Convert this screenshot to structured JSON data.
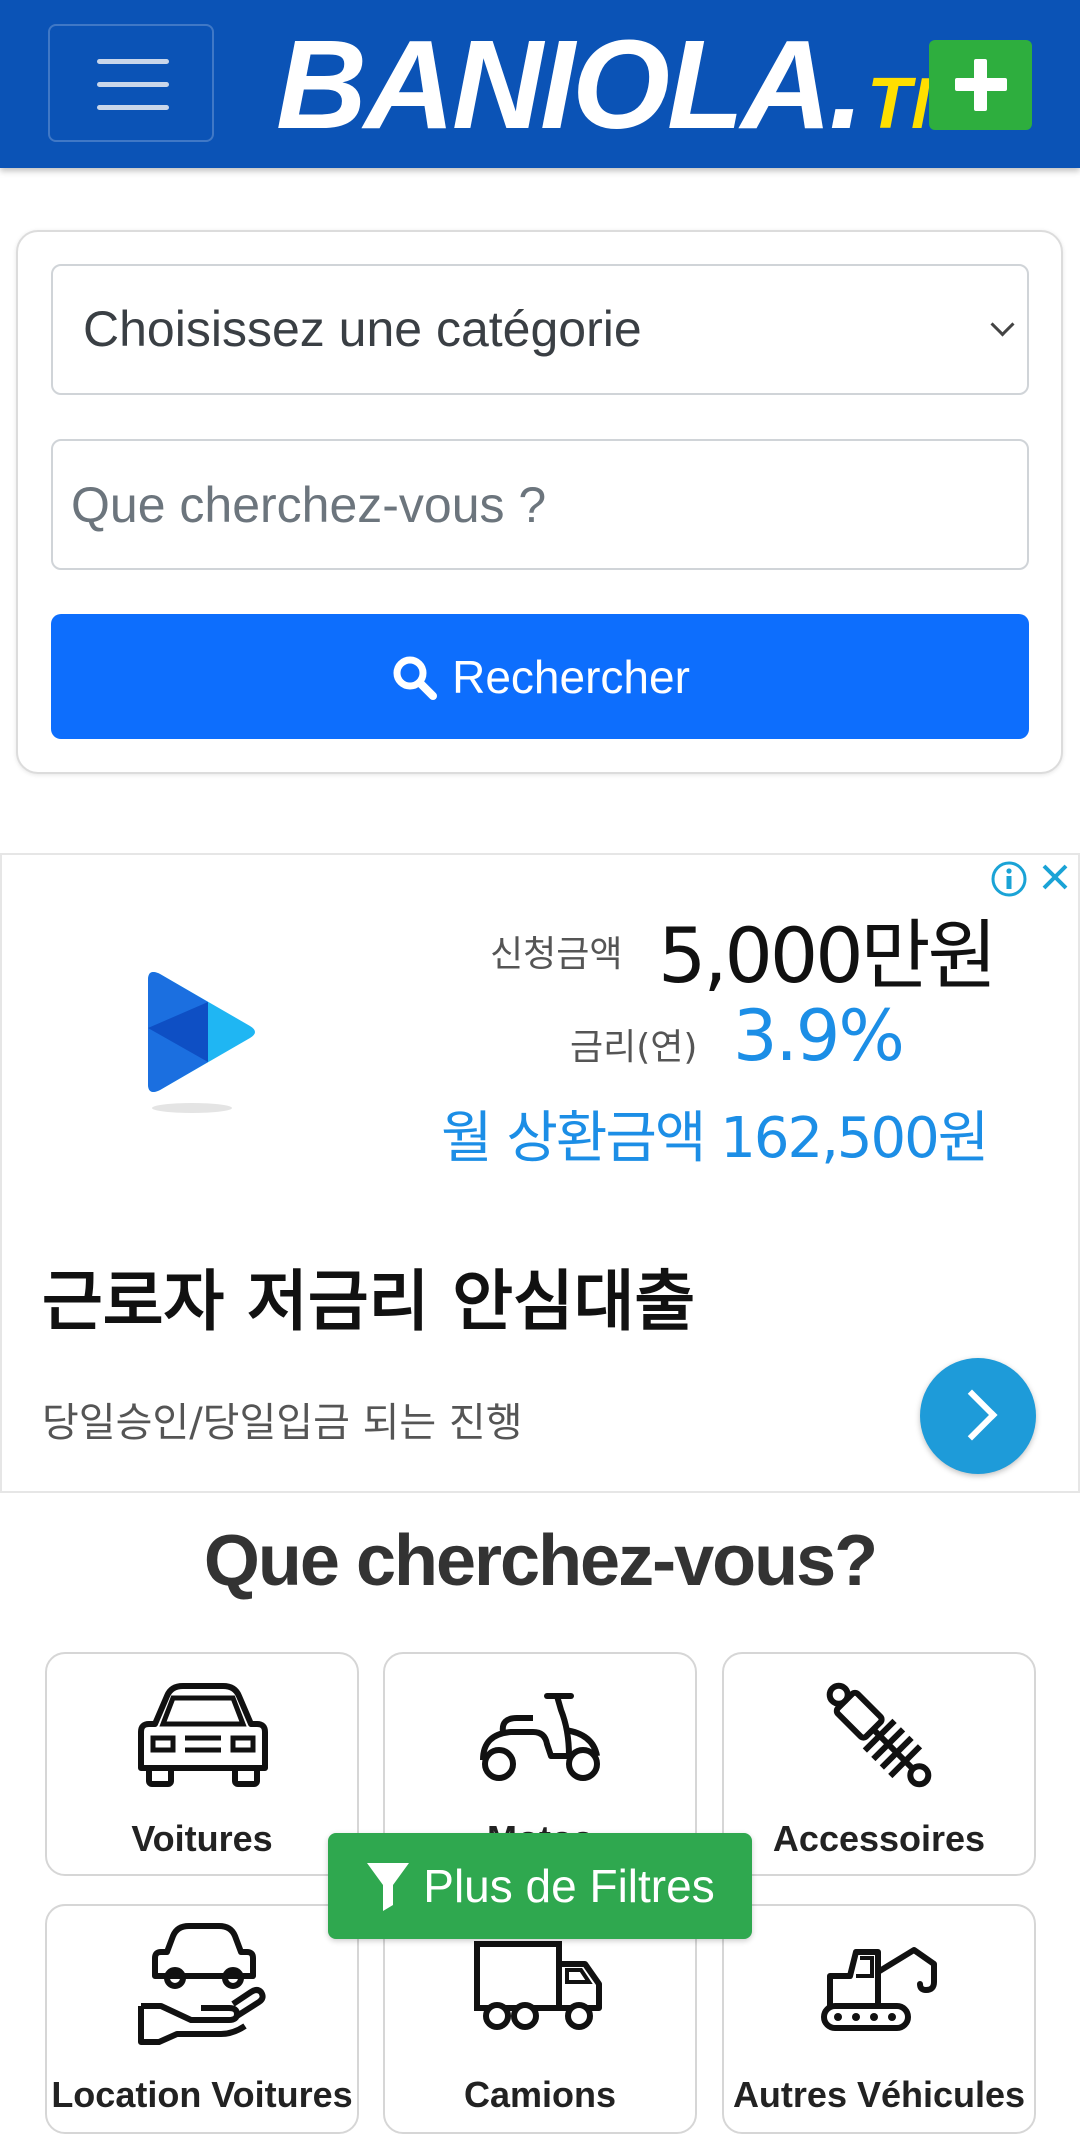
{
  "header": {
    "logo_main": "BANIOLA.",
    "logo_tld": "TN",
    "brand_color": "#0b53b6",
    "accent_color": "#ffdf00",
    "add_button_color": "#2eae3e"
  },
  "search": {
    "category_value": "Choisissez une catégorie",
    "query_placeholder": "Que cherchez-vous ?",
    "query_value": "",
    "button_label": "Rechercher"
  },
  "ad": {
    "amount_label": "신청금액",
    "amount_value": "5,000만원",
    "rate_label": "금리(연)",
    "rate_value": "3.9%",
    "monthly": "월 상환금액 162,500원",
    "headline": "근로자 저금리 안심대출",
    "subtext": "당일승인/당일입금 되는 진행"
  },
  "categories_section": {
    "title": "Que cherchez-vous?",
    "items": [
      {
        "label": "Voitures",
        "icon": "car-icon"
      },
      {
        "label": "Motos",
        "icon": "scooter-icon"
      },
      {
        "label": "Accessoires",
        "icon": "shock-absorber-icon"
      },
      {
        "label": "Location Voitures",
        "icon": "car-rental-icon"
      },
      {
        "label": "Camions",
        "icon": "truck-icon"
      },
      {
        "label": "Autres Véhicules",
        "icon": "excavator-icon"
      }
    ]
  },
  "filters": {
    "button_label": "Plus de Filtres"
  }
}
